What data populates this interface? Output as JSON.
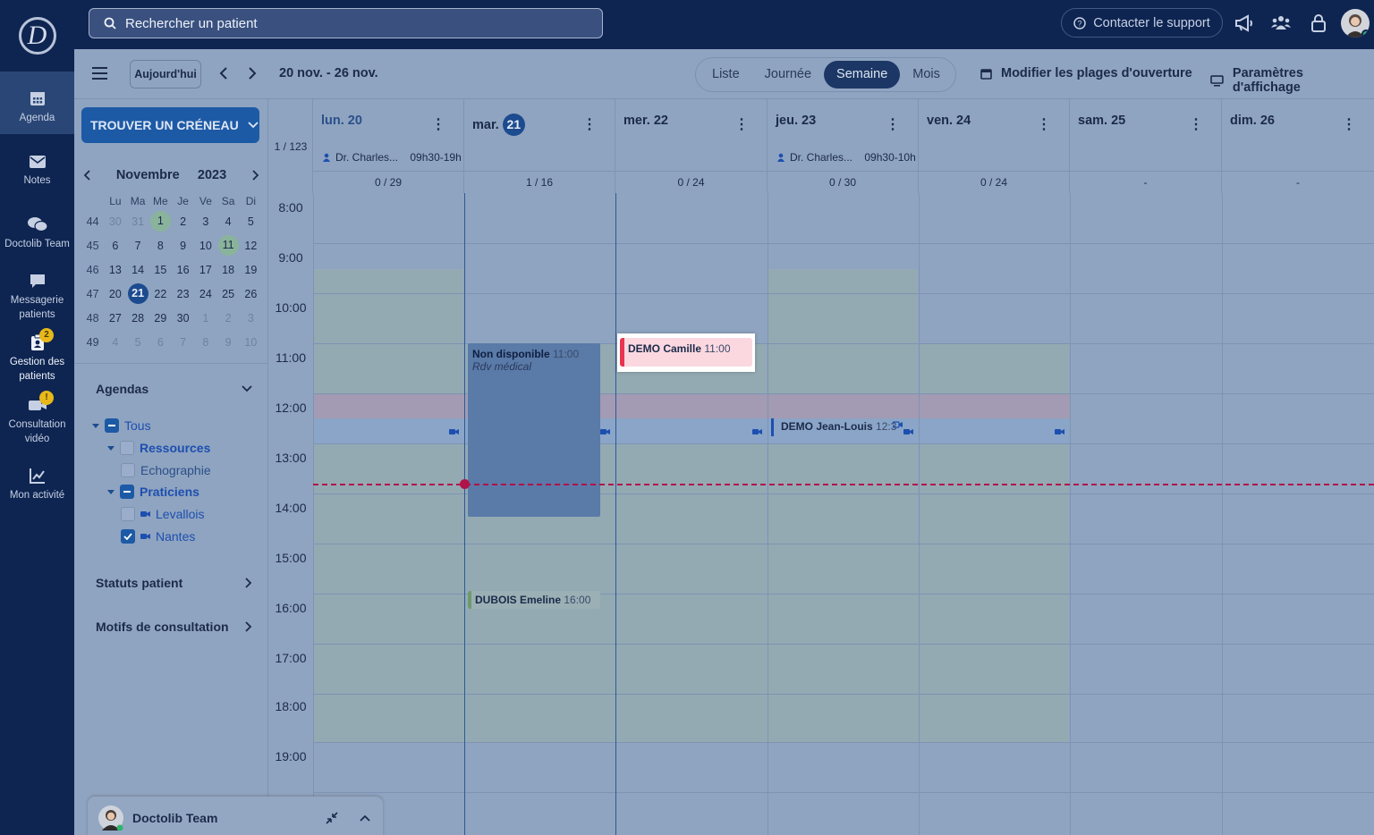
{
  "nav": {
    "logo_letter": "D",
    "items": [
      {
        "label": "Agenda",
        "icon": "calendar-icon"
      },
      {
        "label": "Notes",
        "icon": "mail-icon"
      },
      {
        "label": "Doctolib Team",
        "icon": "chat-bubbles-icon"
      },
      {
        "label": "Messagerie patients",
        "icon": "message-icon"
      },
      {
        "label": "Gestion des patients",
        "icon": "patient-file-icon",
        "badge": "2"
      },
      {
        "label": "Consultation vidéo",
        "icon": "video-icon",
        "badge": "!"
      },
      {
        "label": "Mon activité",
        "icon": "chart-icon"
      }
    ]
  },
  "topbar": {
    "search_placeholder": "Rechercher un patient",
    "support_label": "Contacter le support"
  },
  "toolbar": {
    "today_label": "Aujourd'hui",
    "range": "20 nov. - 26 nov.",
    "views": [
      "Liste",
      "Journée",
      "Semaine",
      "Mois"
    ],
    "selected_view": "Semaine",
    "modify_label": "Modifier les plages d'ouverture",
    "display_label": "Paramètres d'affichage"
  },
  "sidebar": {
    "find_slot_label": "TROUVER UN CRÉNEAU",
    "calendar": {
      "month": "Novembre",
      "year": "2023",
      "weekdays": [
        "Lu",
        "Ma",
        "Me",
        "Je",
        "Ve",
        "Sa",
        "Di"
      ],
      "weeks": [
        {
          "num": "44",
          "days": [
            "30",
            "31",
            "1",
            "2",
            "3",
            "4",
            "5"
          ]
        },
        {
          "num": "45",
          "days": [
            "6",
            "7",
            "8",
            "9",
            "10",
            "11",
            "12"
          ]
        },
        {
          "num": "46",
          "days": [
            "13",
            "14",
            "15",
            "16",
            "17",
            "18",
            "19"
          ]
        },
        {
          "num": "47",
          "days": [
            "20",
            "21",
            "22",
            "23",
            "24",
            "25",
            "26"
          ]
        },
        {
          "num": "48",
          "days": [
            "27",
            "28",
            "29",
            "30",
            "1",
            "2",
            "3"
          ]
        },
        {
          "num": "49",
          "days": [
            "4",
            "5",
            "6",
            "7",
            "8",
            "9",
            "10"
          ]
        }
      ]
    },
    "agendas_label": "Agendas",
    "tree": {
      "all": "Tous",
      "resources": "Ressources",
      "echographie": "Echographie",
      "praticiens": "Praticiens",
      "levallois": "Levallois",
      "nantes": "Nantes"
    },
    "statuts_label": "Statuts patient",
    "motifs_label": "Motifs de consultation",
    "chat_label": "Doctolib Team"
  },
  "calendar": {
    "total_count": "1 / 123",
    "hours": [
      "8:00",
      "9:00",
      "10:00",
      "11:00",
      "12:00",
      "13:00",
      "14:00",
      "15:00",
      "16:00",
      "17:00",
      "18:00",
      "19:00"
    ],
    "days": [
      {
        "label": "lun. 20",
        "count": "0 / 29",
        "prac_name": "Dr. Charles...",
        "prac_hours": "09h30-19h"
      },
      {
        "label": "mar.",
        "num": "21",
        "count": "1 / 16"
      },
      {
        "label": "mer. 22",
        "count": "0 / 24"
      },
      {
        "label": "jeu. 23",
        "count": "0 / 30",
        "prac_name": "Dr. Charles...",
        "prac_hours": "09h30-10h"
      },
      {
        "label": "ven. 24",
        "count": "0 / 24"
      },
      {
        "label": "sam. 25",
        "count": "-"
      },
      {
        "label": "dim. 26",
        "count": "-"
      }
    ],
    "events": {
      "nondispo": {
        "title": "Non disponible",
        "time": "11:00",
        "subtitle": "Rdv médical"
      },
      "demo_camille": {
        "title": "DEMO Camille",
        "time": "11:00"
      },
      "demo_jl": {
        "title": "DEMO Jean-Louis",
        "time": "12:3"
      },
      "dubois": {
        "title": "DUBOIS Emeline",
        "time": "16:00"
      }
    }
  },
  "colors": {
    "nav_bg": "#0e2552",
    "accent": "#1d5aa6",
    "now_line": "#b0124a",
    "event_alert": "#e8344f"
  }
}
